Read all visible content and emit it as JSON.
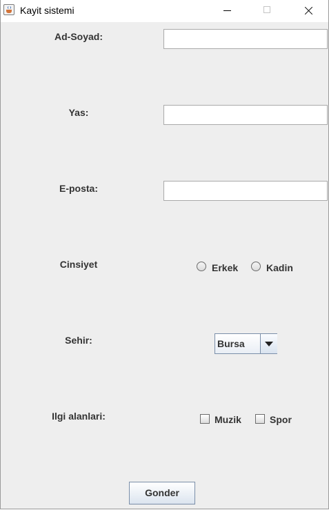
{
  "window": {
    "title": "Kayit sistemi",
    "icon": "java-cup-icon"
  },
  "form": {
    "name_label": "Ad-Soyad:",
    "name_value": "",
    "age_label": "Yas:",
    "age_value": "",
    "email_label": "E-posta:",
    "email_value": "",
    "gender_label": "Cinsiyet",
    "gender_options": [
      "Erkek",
      "Kadin"
    ],
    "city_label": "Sehir:",
    "city_selected": "Bursa",
    "interests_label": "Ilgi alanlari:",
    "interests_options": [
      "Muzik",
      "Spor"
    ],
    "submit_label": "Gonder"
  },
  "colors": {
    "background": "#eeeeee",
    "label_text": "#333333",
    "control_border": "#7a8ea8"
  }
}
